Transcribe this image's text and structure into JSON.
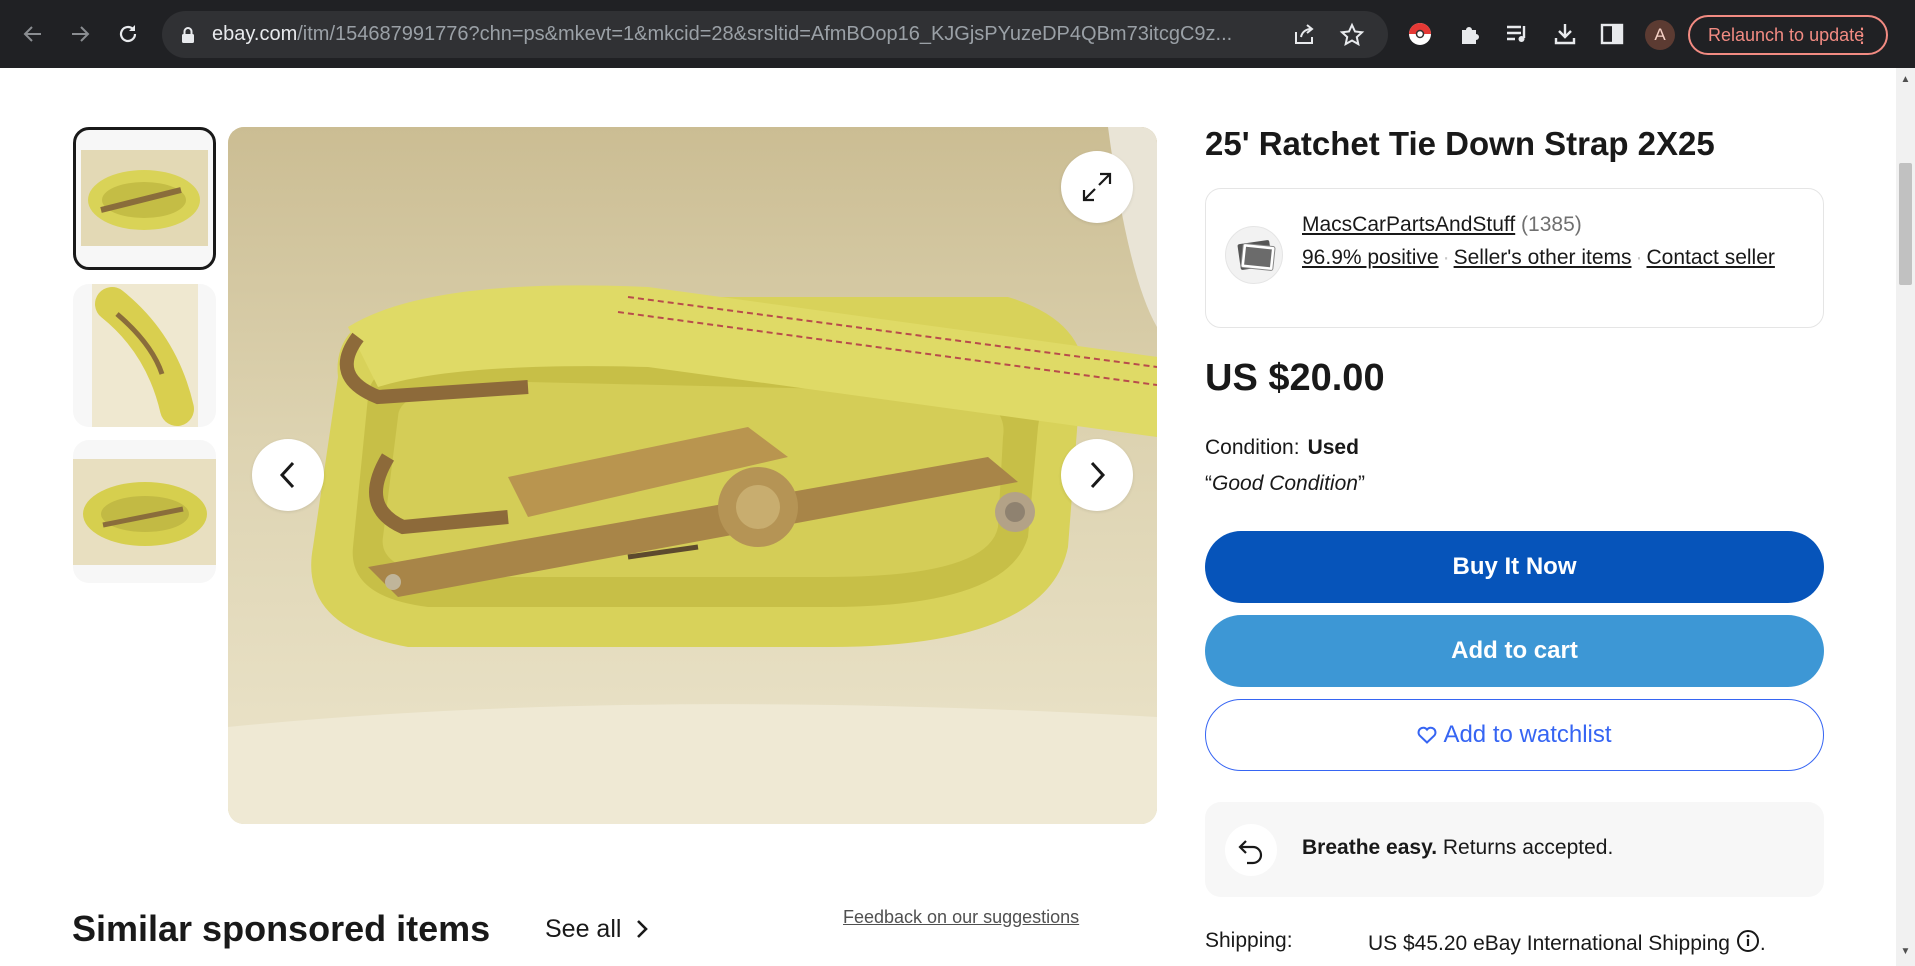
{
  "browser": {
    "url_host": "ebay.com",
    "url_path": "/itm/154687991776?chn=ps&mkevt=1&mkcid=28&srsltid=AfmBOop16_KJGjsPYuzeDP4QBm73itcgC9z...",
    "profile_initial": "A",
    "relaunch_label": "Relaunch to update",
    "relaunch_menu": "⋮"
  },
  "listing": {
    "title": "25' Ratchet Tie Down Strap 2X25",
    "seller": {
      "name": "MacsCarPartsAndStuff",
      "feedback_count": "(1385)",
      "positive": "96.9% positive",
      "dot": "·",
      "other_items": "Seller's other items",
      "contact": "Contact seller"
    },
    "price": "US $20.00",
    "condition_label": "Condition:",
    "condition_value": "Used",
    "condition_note_open": "“",
    "condition_note": "Good Condition",
    "condition_note_close": "”",
    "buttons": {
      "buy": "Buy It Now",
      "cart": "Add to cart",
      "watch": "Add to watchlist"
    },
    "returns_bold": "Breathe easy.",
    "returns_text": " Returns accepted.",
    "shipping_label": "Shipping:",
    "shipping_value": "US $45.20 eBay International Shipping",
    "shipping_trail": "."
  },
  "similar": {
    "heading": "Similar sponsored items",
    "see_all": "See all",
    "feedback": "Feedback on our suggestions"
  },
  "colors": {
    "buy": "#0654ba",
    "cart": "#3d97d5",
    "watch": "#3665f3",
    "chrome_bg": "#202124",
    "relaunch": "#f28b82"
  }
}
